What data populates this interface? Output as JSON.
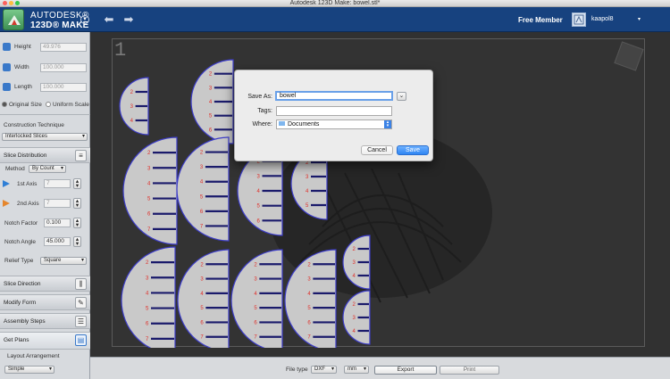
{
  "window": {
    "title": "Autodesk 123D Make: bowel.stl*"
  },
  "app": {
    "brand_line1": "AUTODESK®",
    "brand_line2": "123D® MAKE",
    "membership": "Free Member",
    "username": "kaapol8",
    "accent": "#17427f"
  },
  "sidebar": {
    "height_label": "Height",
    "height_value": "49.976",
    "width_label": "Width",
    "width_value": "100.000",
    "length_label": "Length",
    "length_value": "100.000",
    "original_size": "Original Size",
    "uniform_scale": "Uniform Scale",
    "construction_label": "Construction Technique",
    "construction_value": "Interlocked Slices",
    "slice_distribution": "Slice Distribution",
    "method_label": "Method",
    "method_value": "By Count",
    "axis1_label": "1st Axis",
    "axis1_value": "7",
    "axis2_label": "2nd Axis",
    "axis2_value": "7",
    "notch_factor_label": "Notch Factor",
    "notch_factor_value": "0.100",
    "notch_angle_label": "Notch Angle",
    "notch_angle_value": "45.000",
    "relief_label": "Relief Type",
    "relief_value": "Square",
    "slice_direction": "Slice Direction",
    "modify_form": "Modify Form",
    "assembly_steps": "Assembly Steps",
    "get_plans": "Get Plans",
    "layout_arrangement": "Layout Arrangement",
    "layout_value": "Simple"
  },
  "canvas": {
    "sheet_number": "1"
  },
  "bottom": {
    "file_type_label": "File type",
    "file_type_value": "DXF",
    "unit_value": "mm",
    "export_label": "Export",
    "print_label": "Print"
  },
  "dialog": {
    "save_as_label": "Save As:",
    "save_as_value": "bowel",
    "tags_label": "Tags:",
    "tags_value": "",
    "where_label": "Where:",
    "where_value": "Documents",
    "cancel_label": "Cancel",
    "save_label": "Save"
  },
  "colors": {
    "slice_fill": "#c9c9c9",
    "slice_outline": "#3c3cc8",
    "annotation_red": "#e0302a",
    "primary_button": "#2f86f3"
  }
}
